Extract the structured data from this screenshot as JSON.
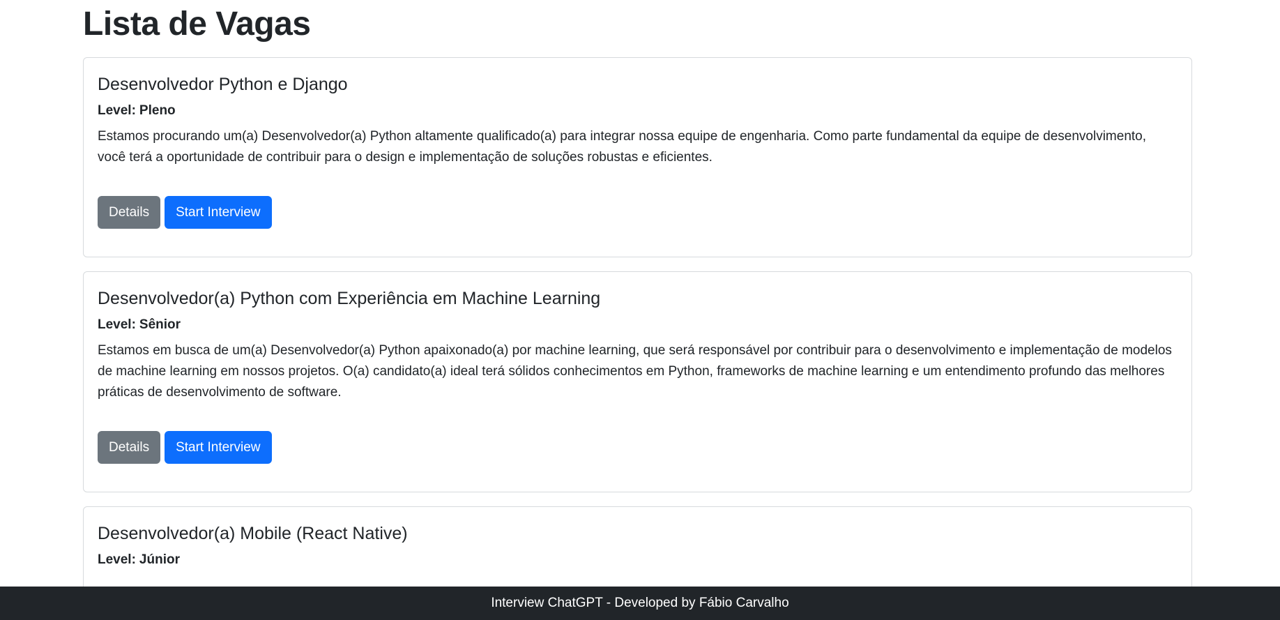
{
  "page": {
    "title": "Lista de Vagas"
  },
  "jobs": [
    {
      "title": "Desenvolvedor Python e Django",
      "level_label": "Level:",
      "level": "Pleno",
      "description": "Estamos procurando um(a) Desenvolvedor(a) Python altamente qualificado(a) para integrar nossa equipe de engenharia. Como parte fundamental da equipe de desenvolvimento, você terá a oportunidade de contribuir para o design e implementação de soluções robustas e eficientes.",
      "details_label": "Details",
      "start_label": "Start Interview"
    },
    {
      "title": "Desenvolvedor(a) Python com Experiência em Machine Learning",
      "level_label": "Level:",
      "level": "Sênior",
      "description": "Estamos em busca de um(a) Desenvolvedor(a) Python apaixonado(a) por machine learning, que será responsável por contribuir para o desenvolvimento e implementação de modelos de machine learning em nossos projetos. O(a) candidato(a) ideal terá sólidos conhecimentos em Python, frameworks de machine learning e um entendimento profundo das melhores práticas de desenvolvimento de software.",
      "details_label": "Details",
      "start_label": "Start Interview"
    },
    {
      "title": "Desenvolvedor(a) Mobile (React Native)",
      "level_label": "Level:",
      "level": "Júnior"
    }
  ],
  "footer": {
    "text": "Interview ChatGPT - Developed by Fábio Carvalho"
  },
  "colors": {
    "primary": "#0d6efd",
    "secondary": "#6c757d",
    "footer_bg": "#212529",
    "card_border": "#d7dadd"
  }
}
